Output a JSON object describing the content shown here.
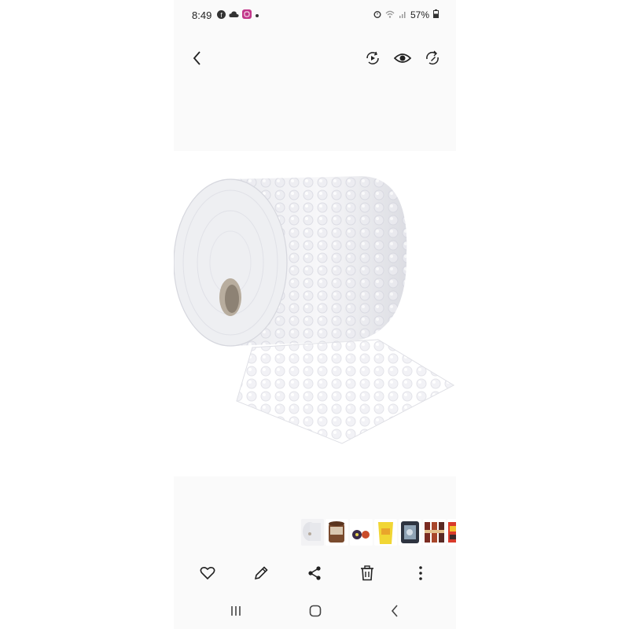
{
  "status_bar": {
    "time": "8:49",
    "battery": "57%",
    "left_icons": [
      "facebook-icon",
      "cloud-icon",
      "instagram-icon",
      "dot-icon"
    ],
    "right_icons": [
      "alarm-icon",
      "wifi-icon",
      "signal-icon",
      "battery-icon"
    ]
  },
  "toolbar": {
    "icons": [
      "back-icon",
      "remaster-icon",
      "view-icon",
      "rotate-icon"
    ]
  },
  "photo": {
    "subject": "bubble-wrap-roll"
  },
  "thumbnails": {
    "count": 7
  },
  "actions": {
    "icons": [
      "favorite-icon",
      "edit-icon",
      "share-icon",
      "delete-icon",
      "more-icon"
    ]
  },
  "nav_bar": {
    "icons": [
      "recents-icon",
      "home-icon",
      "back-icon"
    ]
  },
  "colors": {
    "background": "#ffffff",
    "panel": "#fafafa",
    "icon": "#222222"
  }
}
